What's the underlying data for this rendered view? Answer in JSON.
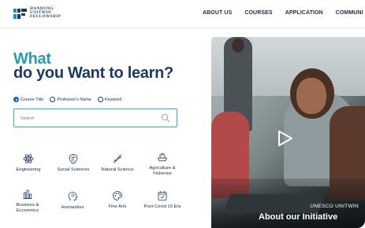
{
  "header": {
    "logo_lines": [
      "HANDONG",
      "UNITWIN",
      "FELLOWSHIP"
    ],
    "nav": [
      "ABOUT US",
      "COURSES",
      "APPLICATION",
      "COMMUNI"
    ]
  },
  "hero": {
    "title_line1": "What",
    "title_line2": "do you Want to learn?"
  },
  "search": {
    "options": [
      "Course Title",
      "Professor's Name",
      "Keyword"
    ],
    "selected": "Course Title",
    "placeholder": "Search"
  },
  "categories": [
    {
      "label": "Engineering",
      "icon": "atom-icon"
    },
    {
      "label": "Social Sciences",
      "icon": "brain-icon"
    },
    {
      "label": "Natural Science",
      "icon": "dna-icon"
    },
    {
      "label": "Agriculture &",
      "label2": "Fisheries",
      "icon": "boat-icon"
    },
    {
      "label": "Business &",
      "label2": "Economics",
      "icon": "chart-icon"
    },
    {
      "label": "Humanities",
      "icon": "head-icon"
    },
    {
      "label": "Fine Arts",
      "icon": "palette-icon"
    },
    {
      "label": "Post-Covid 19 Era",
      "icon": "calendar-icon"
    }
  ],
  "video": {
    "kicker": "UNESCO UNITWIN",
    "title": "About our Initiative"
  },
  "colors": {
    "navy": "#1d3a64",
    "teal": "#2a9bb0",
    "accent_blue": "#1f61b8"
  }
}
